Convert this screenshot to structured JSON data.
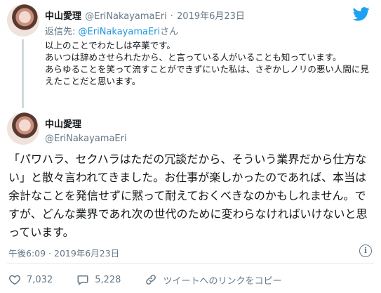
{
  "reply_tweet": {
    "author_name": "中山愛理",
    "handle": "@EriNakayamaEri",
    "separator": "·",
    "date": "2019年6月23日",
    "reply_to_label": "返信先:",
    "reply_to_handle": "@EriNakayamaEri",
    "reply_to_suffix": "さん",
    "text": "以上のことでわたしは卒業です。\nあいつは辞めさせられたから、と言っている人がいることも知っています。\nあらゆることを笑って流すことができずにいた私は、さぞかしノリの悪い人間に見えたことだと思います。"
  },
  "main_tweet": {
    "author_name": "中山愛理",
    "handle": "@EriNakayamaEri",
    "text": "「パワハラ、セクハラはただの冗談だから、そういう業界だから仕方ない」と散々言われてきました。お仕事が楽しかったのであれば、本当は余計なことを発信せずに黙って耐えておくべきなのかもしれません。ですが、どんな業界であれ次の世代のために変わらなければいけないと思っています。",
    "timestamp": "午後6:09 · 2019年6月23日",
    "likes": "7,032",
    "comments": "5,228",
    "share_label": "ツイートへのリンクをコピー"
  },
  "icons": {
    "brand": "twitter-bird-icon",
    "info": "info-icon",
    "like": "heart-icon",
    "comment": "comment-bubble-icon",
    "share": "link-icon"
  },
  "colors": {
    "twitter_blue": "#1da1f2",
    "link_blue": "#1b95e0",
    "muted": "#657786"
  }
}
